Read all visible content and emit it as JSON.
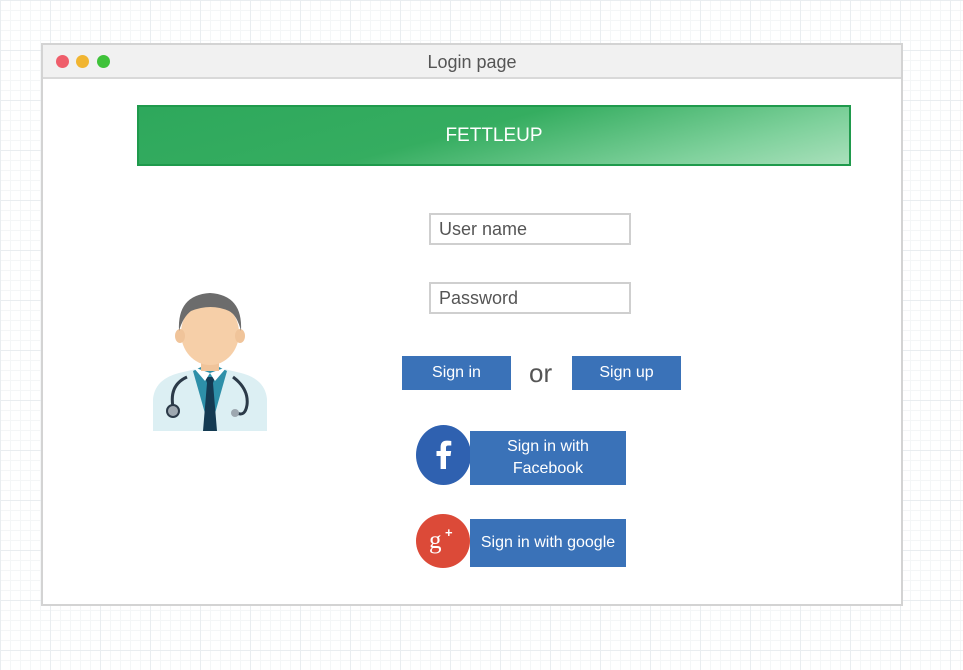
{
  "window": {
    "title": "Login page"
  },
  "banner": {
    "brand": "FETTLEUP"
  },
  "form": {
    "username_placeholder": "User name",
    "password_placeholder": "Password",
    "signin_label": "Sign in",
    "or_label": "or",
    "signup_label": "Sign up"
  },
  "social": {
    "facebook_label": "Sign in with Facebook",
    "google_label": "Sign in with google"
  },
  "colors": {
    "banner_green": "#2ea85c",
    "button_blue": "#3a72b8",
    "facebook_blue": "#2f61b0",
    "google_red": "#dc4a38"
  },
  "icons": [
    "doctor-avatar-icon",
    "facebook-icon",
    "google-plus-icon"
  ]
}
